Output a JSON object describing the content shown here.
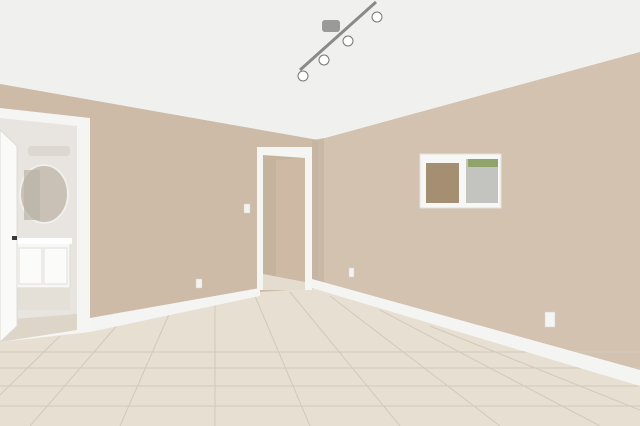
{
  "scene": {
    "description_free": true,
    "colors": {
      "ceiling": "#f1f1ef",
      "wall_left": "#cdbcaa",
      "wall_right": "#d2c1af",
      "wall_shadow": "#bfae9c",
      "baseboard": "#f4f4f2",
      "floor_tile": "#e8e0d3",
      "grout": "#d6ccbd",
      "door_trim": "#f5f5f3",
      "bath_wall": "#e9e6e1",
      "vanity": "#f7f7f5"
    },
    "elements": [
      "track-light-fixture",
      "bathroom-doorway",
      "vanity-mirror",
      "bathroom-vanity",
      "open-door",
      "hallway-doorway",
      "small-window",
      "light-switch",
      "wall-outlets",
      "tile-floor",
      "baseboards"
    ]
  }
}
